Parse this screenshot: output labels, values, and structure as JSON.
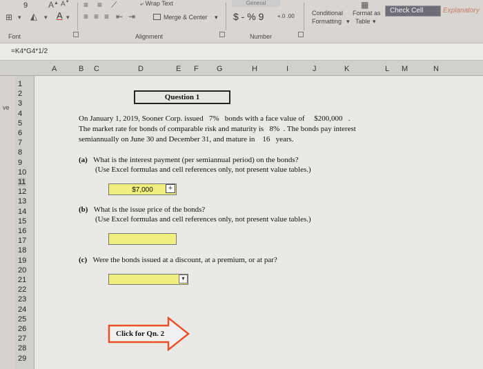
{
  "ribbon": {
    "font_size": "9",
    "wrap_text": "Wrap Text",
    "merge_center": "Merge & Center",
    "number_format": "General",
    "percent_comma": "$ - % 9",
    "dec_inc": "+.0  .00",
    "conditional_formatting_1": "Conditional",
    "conditional_formatting_2": "Formatting",
    "format_as_table_1": "Format as",
    "format_as_table_2": "Table",
    "check_cell": "Check Cell",
    "explanatory": "Explanatory",
    "group_font": "Font",
    "group_alignment": "Alignment",
    "group_number": "Number"
  },
  "formula_bar": {
    "formula": "=K4*G4*1/2"
  },
  "columns": [
    "A",
    "B",
    "C",
    "D",
    "E",
    "F",
    "G",
    "H",
    "I",
    "J",
    "K",
    "L",
    "M",
    "N"
  ],
  "rows": [
    "1",
    "2",
    "3",
    "4",
    "5",
    "6",
    "7",
    "8",
    "9",
    "10",
    "11",
    "12",
    "13",
    "14",
    "15",
    "16",
    "17",
    "18",
    "19",
    "20",
    "21",
    "22",
    "23",
    "24",
    "25",
    "26",
    "27",
    "28",
    "29"
  ],
  "side_label": "ve",
  "question": {
    "title": "Question 1",
    "line1_a": "On January 1, 2019, Sooner Corp. issued",
    "rate": "7%",
    "line1_b": "bonds with a face value of",
    "face_value": "$200,000",
    "line1_c": ".",
    "line2_a": "The market rate for bonds of comparable risk and maturity is",
    "market_rate": "8%",
    "line2_b": ". The bonds pay interest",
    "line3_a": "semiannually on June 30 and December 31, and mature in",
    "years": "16",
    "line3_b": "years.",
    "a_label": "(a)",
    "a_text": "What is the interest payment (per semiannual period) on the bonds?",
    "a_note": "(Use Excel formulas and cell references only, not present value tables.)",
    "a_answer": "$7,000",
    "b_label": "(b)",
    "b_text": "What is the issue price of the bonds?",
    "b_note": "(Use Excel formulas and cell references only, not present value tables.)",
    "c_label": "(c)",
    "c_text": "Were the bonds issued at a discount, at a premium, or at par?",
    "next_button": "Click for Qn. 2"
  }
}
